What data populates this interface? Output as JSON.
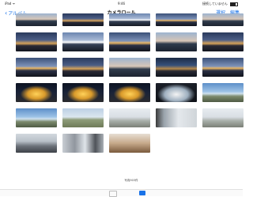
{
  "status": {
    "left": "iPad ᯤ",
    "time": "9:46",
    "right": "接続していません"
  },
  "nav": {
    "back_label": "アルバム",
    "title": "カメラロール",
    "select_label": "選択",
    "edit_label": "編集"
  },
  "grid": {
    "items": [
      {
        "style": "dusk-river"
      },
      {
        "style": "night-river"
      },
      {
        "style": "bridge"
      },
      {
        "style": "blue-hour"
      },
      {
        "style": "dusk-river"
      },
      {
        "style": "night-river"
      },
      {
        "style": "bridge"
      },
      {
        "style": "blue-hour"
      },
      {
        "style": "dusk-river"
      },
      {
        "style": "night-river"
      },
      {
        "style": "blue-hour"
      },
      {
        "style": "night-river"
      },
      {
        "style": "dusk-river"
      },
      {
        "style": "lights-dots"
      },
      {
        "style": "blue-hour"
      },
      {
        "style": "parliament"
      },
      {
        "style": "parliament"
      },
      {
        "style": "parliament"
      },
      {
        "style": "castle"
      },
      {
        "style": "sky-blue"
      },
      {
        "style": "sky-blue"
      },
      {
        "style": "field"
      },
      {
        "style": "hazy"
      },
      {
        "style": "terrace"
      },
      {
        "style": "hazy"
      },
      {
        "style": "city-grey"
      },
      {
        "style": "towers"
      },
      {
        "style": "warm-room"
      }
    ]
  },
  "footer": {
    "count_label": "写真903件"
  }
}
